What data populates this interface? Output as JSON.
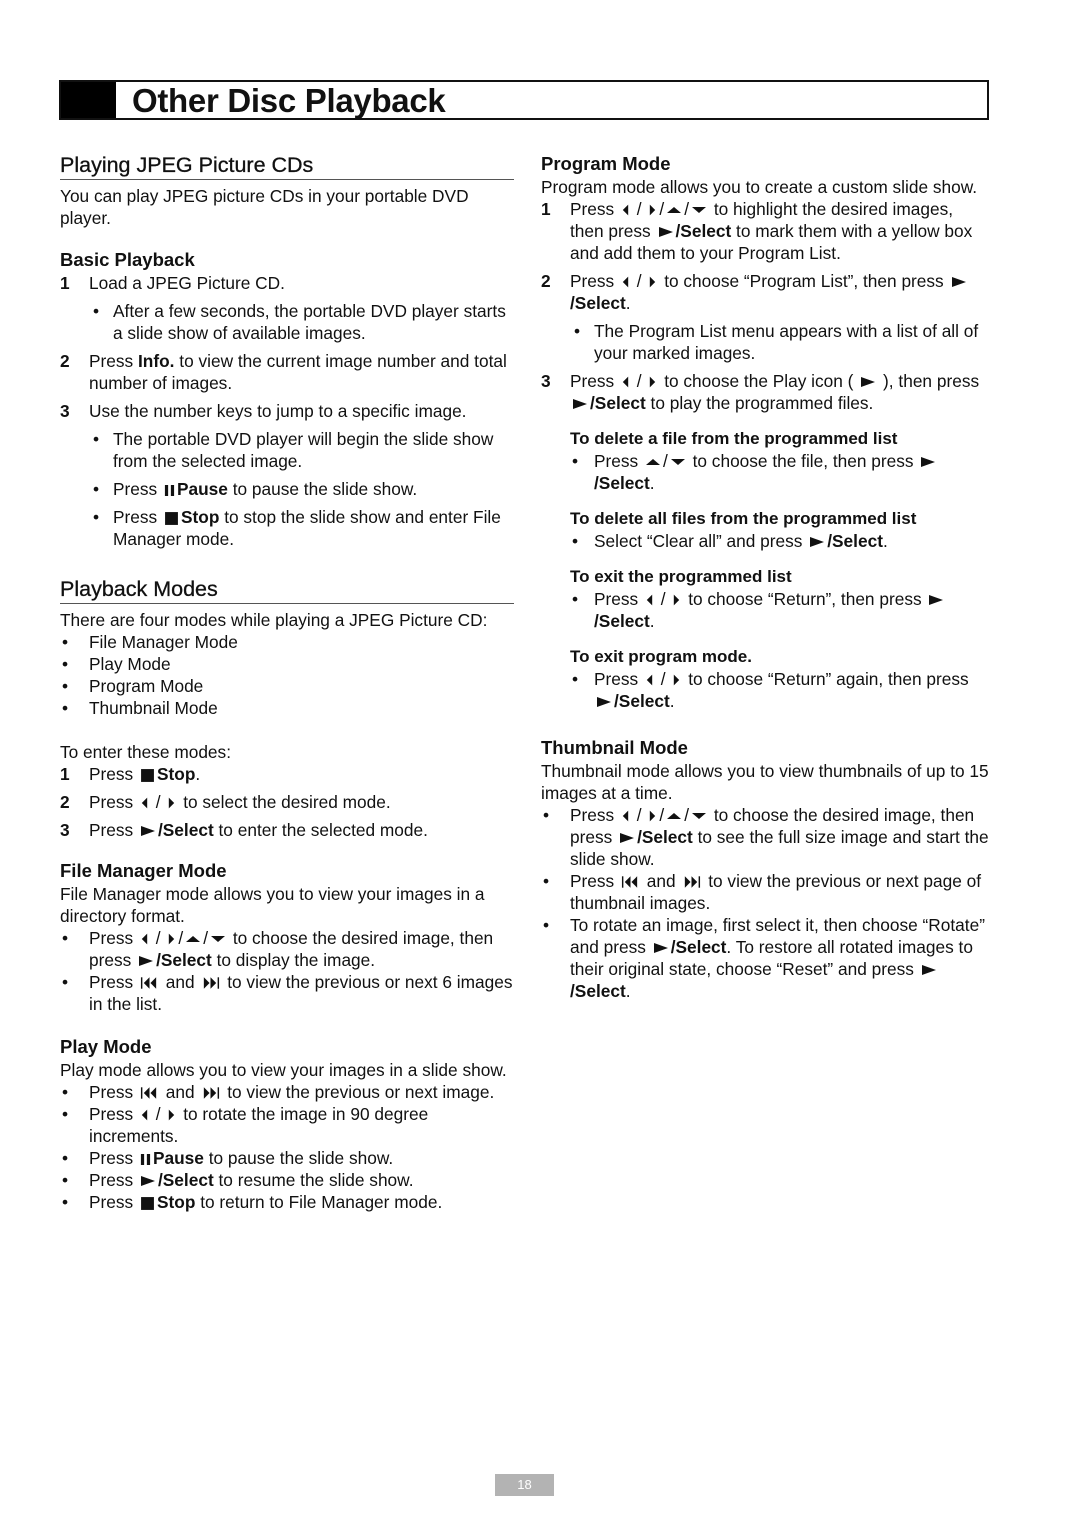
{
  "header": {
    "title": "Other Disc Playback"
  },
  "page_number": "18",
  "left": {
    "jpeg_section": {
      "title": "Playing JPEG Picture CDs",
      "intro": "You can play JPEG picture CDs in your portable DVD player."
    },
    "basic_playback": {
      "title": "Basic Playback",
      "step1": "Load a JPEG Picture CD.",
      "step1_sub": "After a few seconds, the portable DVD player starts a slide show of available images.",
      "step2_pre": "Press ",
      "step2_bold": "Info.",
      "step2_post": " to view the current image number and total number of images.",
      "step3": "Use the number keys to jump to a specific image.",
      "step3_sub1": "The portable DVD player will begin the slide show from the selected image.",
      "step3_sub2_pre": "Press ",
      "step3_sub2_bold": "Pause",
      "step3_sub2_post": " to pause the slide show.",
      "step3_sub3_pre": "Press ",
      "step3_sub3_bold": "Stop",
      "step3_sub3_post": " to stop the slide show and enter File Manager mode."
    },
    "playback_modes": {
      "title": "Playback Modes",
      "intro": "There are four modes while playing a JPEG Picture CD:",
      "modes": [
        "File Manager Mode",
        "Play Mode",
        "Program Mode",
        "Thumbnail Mode"
      ],
      "enter_label": "To enter these modes:",
      "step1_pre": "Press ",
      "step1_bold": "Stop",
      "step1_post": ".",
      "step2_pre": "Press ",
      "step2_post": " to select the desired mode.",
      "step3_pre": "Press ",
      "step3_bold": "/Select",
      "step3_post": " to enter the selected mode."
    },
    "file_manager": {
      "title": "File Manager Mode",
      "intro": "File Manager mode allows you to view your images in a directory format.",
      "b1_pre": "Press ",
      "b1_mid": " to choose the desired image, then press ",
      "b1_bold": "/Select",
      "b1_post": " to display the image.",
      "b2_pre": "Press ",
      "b2_and": " and ",
      "b2_post": " to view the previous or next 6 images in the list."
    },
    "play_mode": {
      "title": "Play Mode",
      "intro": "Play mode allows you to view your images in a slide show.",
      "b1_pre": "Press ",
      "b1_and": " and ",
      "b1_post": " to view the previous or next image.",
      "b2_pre": "Press ",
      "b2_post": " to rotate the image in 90 degree increments.",
      "b3_pre": "Press ",
      "b3_bold": "Pause",
      "b3_post": " to pause the slide show.",
      "b4_pre": "Press ",
      "b4_bold": "/Select",
      "b4_post": " to resume the slide show.",
      "b5_pre": "Press ",
      "b5_bold": "Stop",
      "b5_post": " to return to File Manager mode."
    }
  },
  "right": {
    "program_mode": {
      "title": "Program Mode",
      "intro": "Program mode allows you to create a custom slide show.",
      "s1_pre": "Press ",
      "s1_mid": " to highlight the desired images, then press ",
      "s1_bold": "/Select",
      "s1_post": " to mark them with a yellow box and add them to your Program List.",
      "s2_pre": "Press ",
      "s2_mid": " to choose “Program List”, then press ",
      "s2_bold": "/Select",
      "s2_post": ".",
      "s2_sub": "The Program List menu appears with a list of all of your marked images.",
      "s3_pre": "Press ",
      "s3_mid": " to choose the Play icon ( ",
      "s3_mid2": " ), then press ",
      "s3_bold": "/Select",
      "s3_post": " to play the programmed files.",
      "delete_one": {
        "title": "To delete a file from the programmed list",
        "pre": "Press ",
        "mid": " to choose the file, then press ",
        "bold": "/Select",
        "post": "."
      },
      "delete_all": {
        "title": "To delete all files from the programmed list",
        "pre": "Select “Clear all” and press ",
        "bold": "/Select",
        "post": "."
      },
      "exit_list": {
        "title": "To exit the programmed list",
        "pre": "Press ",
        "mid": " to choose “Return”, then press ",
        "bold": "/Select",
        "post": "."
      },
      "exit_mode": {
        "title": "To exit program mode.",
        "pre": "Press ",
        "mid": " to choose “Return” again, then press ",
        "bold": "/Select",
        "post": "."
      }
    },
    "thumbnail_mode": {
      "title": "Thumbnail Mode",
      "intro": "Thumbnail mode allows you to view thumbnails of up to 15 images at a time.",
      "b1_pre": "Press ",
      "b1_mid": " to choose the desired image, then press ",
      "b1_bold": "/Select",
      "b1_post": " to see the full size image and start the slide show.",
      "b2_pre": "Press ",
      "b2_and": " and ",
      "b2_post": " to view the previous or next page of thumbnail images.",
      "b3_pre": "To rotate an image, first select it, then choose “Rotate” and press ",
      "b3_bold": "/Select",
      "b3_mid": ". To restore all rotated images to their original state, choose “Reset” and press ",
      "b3_bold2": "/Select",
      "b3_post": "."
    }
  },
  "glyphs": {
    "bullet": "•",
    "slash": " / "
  }
}
